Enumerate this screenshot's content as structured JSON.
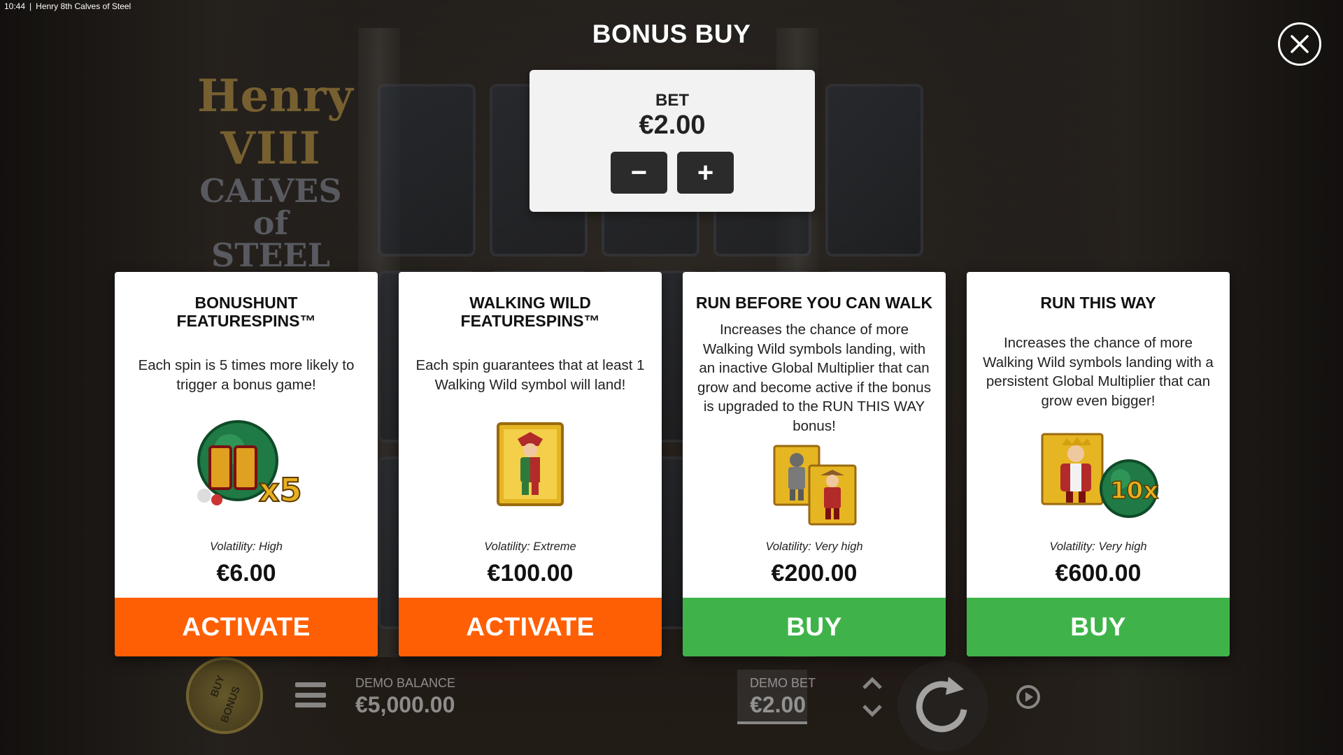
{
  "status_bar": {
    "time": "10:44",
    "separator": "|",
    "window_title": "Henry 8th Calves of Steel"
  },
  "logo": {
    "line1": "Henry VIII",
    "line2": "CALVES",
    "line3": "of STEEL"
  },
  "title": "BONUS BUY",
  "bet": {
    "label": "BET",
    "value": "€2.00",
    "decrease_label": "−",
    "increase_label": "+"
  },
  "cards": [
    {
      "title_line1": "BONUSHUNT",
      "title_line2": "FEATURESPINS™",
      "description": "Each spin is 5 times more likely to trigger a bonus game!",
      "art": "fs-x5-icon",
      "volatility": "Volatility: High",
      "price": "€6.00",
      "action": "ACTIVATE",
      "action_color": "#ff5f04"
    },
    {
      "title_line1": "WALKING WILD",
      "title_line2": "FEATURESPINS™",
      "description": "Each spin guarantees that at least 1 Walking Wild symbol will land!",
      "art": "jester-wild-icon",
      "volatility": "Volatility: Extreme",
      "price": "€100.00",
      "action": "ACTIVATE",
      "action_color": "#ff5f04"
    },
    {
      "title_line1": "RUN BEFORE YOU CAN WALK",
      "title_line2": "",
      "description": "Increases the chance of more Walking Wild symbols landing, with an inactive Global Multiplier that can grow and become active if the bonus is upgraded to the RUN THIS WAY bonus!",
      "art": "knight-and-jester-icon",
      "volatility": "Volatility: Very high",
      "price": "€200.00",
      "action": "BUY",
      "action_color": "#3fb34a"
    },
    {
      "title_line1": "RUN THIS WAY",
      "title_line2": "",
      "description": "Increases the chance of more Walking Wild symbols landing with a persistent Global Multiplier that can grow even bigger!",
      "art": "king-10x-icon",
      "multiplier_badge": "10x",
      "volatility": "Volatility: Very high",
      "price": "€600.00",
      "action": "BUY",
      "action_color": "#3fb34a"
    }
  ],
  "hud": {
    "buy_bonus_line1": "BUY",
    "buy_bonus_line2": "BONUS",
    "demo_balance_label": "DEMO BALANCE",
    "demo_balance_value": "€5,000.00",
    "demo_bet_label": "DEMO BET",
    "demo_bet_value": "€2.00"
  }
}
